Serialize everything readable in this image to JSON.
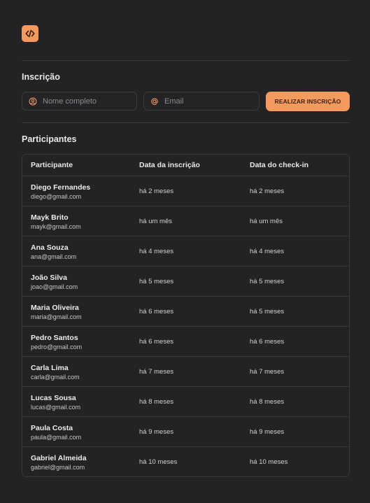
{
  "brand": {
    "logo_icon": "code-icon",
    "accent": "#f59a5f"
  },
  "signup": {
    "title": "Inscrição",
    "name_placeholder": "Nome completo",
    "email_placeholder": "Email",
    "submit_label": "REALIZAR INSCRIÇÃO"
  },
  "participants": {
    "title": "Participantes",
    "columns": [
      "Participante",
      "Data da inscrição",
      "Data do check-in"
    ],
    "rows": [
      {
        "name": "Diego Fernandes",
        "email": "diego@gmail.com",
        "registered": "há 2 meses",
        "checkin": "há 2 meses"
      },
      {
        "name": "Mayk Brito",
        "email": "mayk@gmail.com",
        "registered": "há um mês",
        "checkin": "há um mês"
      },
      {
        "name": "Ana Souza",
        "email": "ana@gmail.com",
        "registered": "há 4 meses",
        "checkin": "há 4 meses"
      },
      {
        "name": "João Silva",
        "email": "joao@gmail.com",
        "registered": "há 5 meses",
        "checkin": "há 5 meses"
      },
      {
        "name": "Maria Oliveira",
        "email": "maria@gmail.com",
        "registered": "há 6 meses",
        "checkin": "há 5 meses"
      },
      {
        "name": "Pedro Santos",
        "email": "pedro@gmail.com",
        "registered": "há 6 meses",
        "checkin": "há 6 meses"
      },
      {
        "name": "Carla Lima",
        "email": "carla@gmail.com",
        "registered": "há 7 meses",
        "checkin": "há 7 meses"
      },
      {
        "name": "Lucas Sousa",
        "email": "lucas@gmail.com",
        "registered": "há 8 meses",
        "checkin": "há 8 meses"
      },
      {
        "name": "Paula Costa",
        "email": "paula@gmail.com",
        "registered": "há 9 meses",
        "checkin": "há 9 meses"
      },
      {
        "name": "Gabriel Almeida",
        "email": "gabriel@gmail.com",
        "registered": "há 10 meses",
        "checkin": "há 10 meses"
      }
    ]
  }
}
